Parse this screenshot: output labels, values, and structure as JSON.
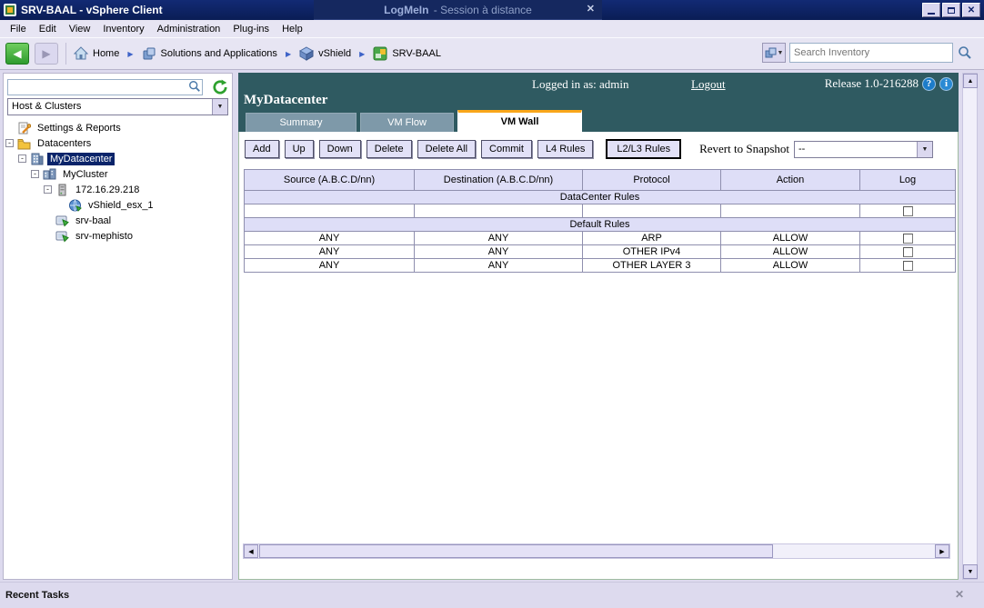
{
  "window": {
    "title": "SRV-BAAL - vSphere Client"
  },
  "remote_bar": {
    "app": "LogMeIn",
    "session": " - Session à distance",
    "close": "✕"
  },
  "menu": {
    "items": [
      "File",
      "Edit",
      "View",
      "Inventory",
      "Administration",
      "Plug-ins",
      "Help"
    ]
  },
  "toolbar": {
    "breadcrumb": [
      {
        "label": "Home"
      },
      {
        "label": "Solutions and Applications"
      },
      {
        "label": "vShield"
      },
      {
        "label": "SRV-BAAL"
      }
    ],
    "search": {
      "placeholder": "Search Inventory"
    }
  },
  "sidebar": {
    "view_selector": "Host & Clusters",
    "tree": [
      {
        "label": "Settings & Reports",
        "icon": "settings-reports-icon"
      },
      {
        "label": "Datacenters",
        "icon": "folder-icon"
      },
      {
        "label": "MyDatacenter",
        "icon": "datacenter-icon",
        "selected": true
      },
      {
        "label": "MyCluster",
        "icon": "cluster-icon"
      },
      {
        "label": "172.16.29.218",
        "icon": "host-icon"
      },
      {
        "label": "vShield_esx_1",
        "icon": "vshield-appliance-icon"
      },
      {
        "label": "srv-baal",
        "icon": "vm-icon"
      },
      {
        "label": "srv-mephisto",
        "icon": "vm-icon"
      }
    ]
  },
  "header": {
    "logged_in_as": "Logged in as: admin",
    "logout": "Logout",
    "release": "Release 1.0-216288",
    "entity_name": "MyDatacenter",
    "tabs": [
      {
        "label": "Summary",
        "active": false
      },
      {
        "label": "VM Flow",
        "active": false
      },
      {
        "label": "VM Wall",
        "active": true
      }
    ]
  },
  "actions": {
    "buttons": [
      "Add",
      "Up",
      "Down",
      "Delete",
      "Delete All",
      "Commit",
      "L4 Rules",
      "L2/L3 Rules"
    ],
    "active_button": "L2/L3 Rules",
    "revert_label": "Revert to Snapshot",
    "revert_value": "--"
  },
  "rules_table": {
    "columns": [
      "Source (A.B.C.D/nn)",
      "Destination (A.B.C.D/nn)",
      "Protocol",
      "Action",
      "Log"
    ],
    "sections": [
      {
        "title": "DataCenter Rules",
        "rows": [
          {
            "source": "",
            "destination": "",
            "protocol": "",
            "action": "",
            "log_checked": false
          }
        ]
      },
      {
        "title": "Default Rules",
        "rows": [
          {
            "source": "ANY",
            "destination": "ANY",
            "protocol": "ARP",
            "action": "ALLOW",
            "log_checked": false
          },
          {
            "source": "ANY",
            "destination": "ANY",
            "protocol": "OTHER IPv4",
            "action": "ALLOW",
            "log_checked": false
          },
          {
            "source": "ANY",
            "destination": "ANY",
            "protocol": "OTHER LAYER 3",
            "action": "ALLOW",
            "log_checked": false
          }
        ]
      }
    ]
  },
  "footer": {
    "recent_tasks": "Recent Tasks",
    "close": "✕"
  },
  "colors": {
    "titlebar": "#0B2268",
    "header_teal": "#2F5A61",
    "active_tab_accent": "#F9A61A",
    "selection": "#0A246A",
    "panel_lavender": "#DDDAEE",
    "table_header": "#DEDEF7"
  }
}
